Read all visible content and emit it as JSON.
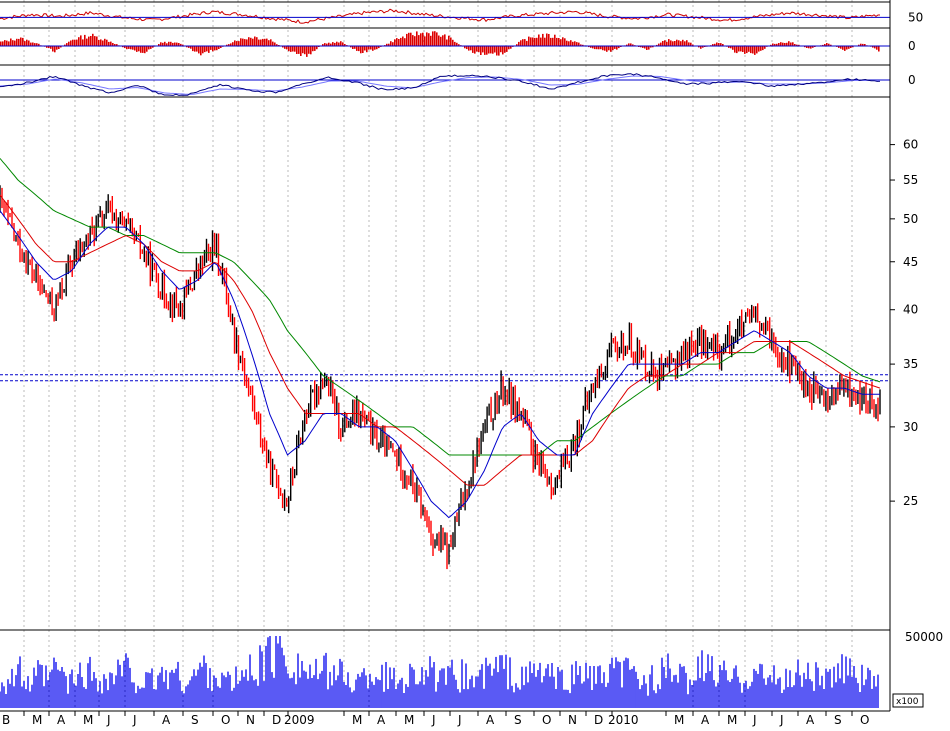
{
  "chart_data": [
    {
      "type": "line",
      "panel": "oscillator-1",
      "series": [
        {
          "values": [
            48,
            55,
            52,
            58,
            50,
            45,
            52,
            60,
            55,
            48,
            42,
            50,
            58,
            62,
            55,
            50,
            46,
            53,
            57,
            60,
            52,
            48,
            55,
            50,
            45,
            52,
            58,
            54,
            49,
            55
          ]
        }
      ],
      "reference_lines": [
        50
      ],
      "y_tick_labels": [
        "50"
      ],
      "colors": {
        "line": "#cc0000",
        "reference": "#0000cc"
      }
    },
    {
      "type": "bar",
      "panel": "oscillator-2",
      "values": [
        0.3,
        0.6,
        0.2,
        -0.4,
        0.5,
        0.8,
        0.4,
        -0.2,
        -0.5,
        0.3,
        0.2,
        -0.6,
        -0.3,
        0.4,
        0.7,
        0.5,
        -0.4,
        -0.8,
        0.2,
        0.3,
        -0.5,
        -0.2,
        0.5,
        0.9,
        1.0,
        0.6,
        -0.3,
        -0.7,
        -0.6,
        0.4,
        0.8,
        0.7,
        0.3,
        -0.2,
        -0.4,
        0.2,
        -0.3,
        0.4,
        0.5,
        -0.2,
        0.3,
        -0.5,
        -0.6,
        0.2,
        0.3,
        -0.2,
        0.2,
        -0.3,
        0.2,
        -0.4
      ],
      "y_tick_labels": [
        "0"
      ],
      "colors": {
        "bar": "#dd0000",
        "reference": "#0000cc"
      }
    },
    {
      "type": "line",
      "panel": "oscillator-3",
      "series": [
        {
          "values": [
            -1.5,
            -0.5,
            0.8,
            -1.2,
            -2.5,
            -1.0,
            -3.2,
            -2.8,
            -1.0,
            -2.0,
            -2.5,
            -0.8,
            0.5,
            -0.6,
            -2.0,
            -1.6,
            0.6,
            1.0,
            0.5,
            -0.3,
            -1.8,
            -0.5,
            0.8,
            1.2,
            0.4,
            -0.8,
            -0.6,
            -0.2,
            -1.2,
            -0.8,
            -0.5,
            0.2,
            -0.2
          ]
        },
        {
          "values": [
            -1.2,
            -0.8,
            0.2,
            -0.6,
            -1.8,
            -1.5,
            -2.6,
            -2.9,
            -1.8,
            -1.9,
            -2.2,
            -1.4,
            -0.2,
            -0.2,
            -1.2,
            -1.6,
            -0.4,
            0.5,
            0.6,
            0.1,
            -1.0,
            -0.9,
            0.1,
            0.8,
            0.7,
            -0.1,
            -0.5,
            -0.4,
            -0.8,
            -0.8,
            -0.6,
            -0.1,
            -0.1
          ]
        }
      ],
      "y_tick_labels": [
        "0"
      ],
      "colors": {
        "line_a": "#000080",
        "line_b": "#7777ff",
        "reference": "#0000cc"
      }
    },
    {
      "type": "line",
      "panel": "price",
      "x_axis_labels": [
        "M",
        "A",
        "M",
        "J",
        "J",
        "A",
        "S",
        "O",
        "N",
        "D",
        "2009",
        "M",
        "A",
        "M",
        "J",
        "J",
        "A",
        "S",
        "O",
        "N",
        "D",
        "2010",
        "M",
        "A",
        "M",
        "J",
        "J",
        "A",
        "S",
        "O"
      ],
      "x_axis_first_label": "B",
      "y_scale": "log",
      "ylim": [
        20,
        65
      ],
      "y_tick_values": [
        60,
        55,
        50,
        45,
        40,
        35,
        30,
        25
      ],
      "y_tick_labels": [
        "60",
        "55",
        "50",
        "45",
        "40",
        "35",
        "30",
        "25"
      ],
      "grid": "vertical dotted month lines",
      "horizontal_reference_lines": [
        34.1,
        33.6
      ],
      "series": [
        {
          "kind": "close",
          "values": [
            52,
            47,
            43,
            40,
            45,
            48,
            51,
            49,
            46,
            42,
            40,
            44,
            47,
            38,
            32,
            27,
            25,
            31,
            34,
            30,
            31,
            29,
            28,
            26,
            23,
            22,
            26,
            30,
            33,
            31,
            27,
            26,
            29,
            33,
            36,
            37,
            35,
            34,
            36,
            37,
            36,
            38,
            39,
            37,
            35,
            33,
            32,
            33,
            32,
            32
          ]
        },
        {
          "kind": "moving-average-short",
          "values": [
            51,
            48,
            45,
            43,
            44,
            47,
            49,
            49,
            47,
            44,
            42,
            43,
            45,
            41,
            36,
            31,
            28,
            29,
            31,
            31,
            30,
            30,
            29,
            27,
            25,
            24,
            25,
            27,
            30,
            31,
            29,
            28,
            28,
            31,
            33,
            35,
            35,
            35,
            35,
            36,
            36,
            37,
            38,
            37,
            36,
            34,
            33,
            33,
            32.5,
            32.5
          ]
        },
        {
          "kind": "moving-average-medium",
          "values": [
            53,
            50,
            47,
            45,
            45,
            46,
            47,
            48,
            47,
            45,
            44,
            44,
            45,
            43,
            40,
            36,
            33,
            31,
            31,
            31,
            31,
            30,
            30,
            29,
            28,
            27,
            26,
            26,
            27,
            28,
            28,
            28,
            28,
            29,
            31,
            33,
            34,
            34,
            35,
            35,
            36,
            36,
            37,
            37,
            37,
            36,
            35,
            34,
            33.5,
            33
          ]
        },
        {
          "kind": "moving-average-long",
          "values": [
            58,
            55,
            53,
            51,
            50,
            49,
            49,
            48,
            48,
            47,
            46,
            46,
            46,
            45,
            43,
            41,
            38,
            36,
            34,
            33,
            32,
            31,
            30,
            30,
            29,
            28,
            28,
            28,
            28,
            28,
            28,
            29,
            29,
            30,
            31,
            32,
            33,
            34,
            34,
            35,
            35,
            36,
            36,
            37,
            37,
            37,
            36,
            35,
            34,
            33.5
          ]
        }
      ],
      "colors": {
        "up_bar": "#000000",
        "down_bar": "#ff0000",
        "ma_short": "#0000cc",
        "ma_medium": "#dd0000",
        "ma_long": "#008800",
        "reference": "#0000cc",
        "grid": "#bbbbbb"
      }
    },
    {
      "type": "bar",
      "panel": "volume",
      "values": [
        22,
        25,
        30,
        18,
        28,
        24,
        35,
        20,
        26,
        31,
        27,
        22,
        29,
        33,
        25,
        20,
        24,
        28,
        30,
        22,
        26,
        35,
        29,
        24,
        21,
        27,
        32,
        38,
        45,
        50,
        41,
        36,
        30,
        27,
        33,
        29,
        24,
        22,
        28,
        31,
        26,
        23,
        27,
        30,
        34,
        25,
        22,
        29,
        27,
        24,
        28,
        32,
        35,
        26,
        23,
        29,
        31,
        27,
        22,
        25,
        30,
        28,
        24,
        26,
        33,
        29,
        25,
        22,
        27,
        31,
        26,
        24,
        29,
        35,
        30,
        27,
        25,
        28,
        32,
        26,
        24,
        22,
        27,
        30,
        28,
        25,
        23,
        29,
        46,
        26,
        24,
        28
      ],
      "y_tick_labels": [
        "50000"
      ],
      "unit_label": "x100",
      "colors": {
        "bar": "#0000ee"
      }
    }
  ]
}
